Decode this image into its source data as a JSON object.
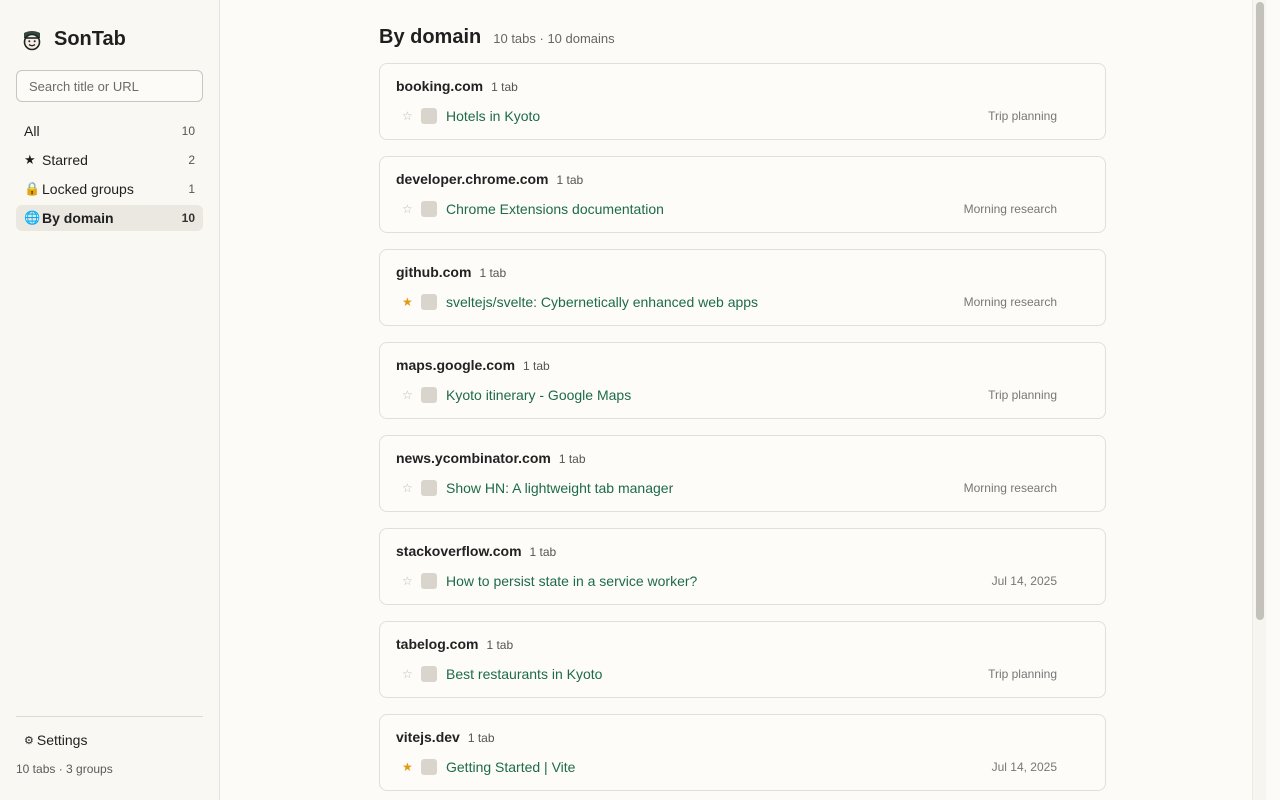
{
  "sidebar": {
    "brand": "SonTab",
    "search_placeholder": "Search title or URL",
    "nav": [
      {
        "icon": "",
        "label": "All",
        "count": "10",
        "active": false
      },
      {
        "icon": "★",
        "label": "Starred",
        "count": "2",
        "active": false
      },
      {
        "icon": "🔒",
        "label": "Locked groups",
        "count": "1",
        "active": false
      },
      {
        "icon": "🌐",
        "label": "By domain",
        "count": "10",
        "active": true
      }
    ],
    "settings_icon": "⚙",
    "settings_label": "Settings",
    "summary": "10 tabs · 3 groups"
  },
  "main": {
    "title": "By domain",
    "subtitle": "10 tabs · 10 domains",
    "groups": [
      {
        "domain": "booking.com",
        "count": "1 tab",
        "tabs": [
          {
            "title": "Hotels in Kyoto",
            "meta": "Trip planning",
            "starred": false
          }
        ]
      },
      {
        "domain": "developer.chrome.com",
        "count": "1 tab",
        "tabs": [
          {
            "title": "Chrome Extensions documentation",
            "meta": "Morning research",
            "starred": false
          }
        ]
      },
      {
        "domain": "github.com",
        "count": "1 tab",
        "tabs": [
          {
            "title": "sveltejs/svelte: Cybernetically enhanced web apps",
            "meta": "Morning research",
            "starred": true
          }
        ]
      },
      {
        "domain": "maps.google.com",
        "count": "1 tab",
        "tabs": [
          {
            "title": "Kyoto itinerary - Google Maps",
            "meta": "Trip planning",
            "starred": false
          }
        ]
      },
      {
        "domain": "news.ycombinator.com",
        "count": "1 tab",
        "tabs": [
          {
            "title": "Show HN: A lightweight tab manager",
            "meta": "Morning research",
            "starred": false
          }
        ]
      },
      {
        "domain": "stackoverflow.com",
        "count": "1 tab",
        "tabs": [
          {
            "title": "How to persist state in a service worker?",
            "meta": "Jul 14, 2025",
            "starred": false
          }
        ]
      },
      {
        "domain": "tabelog.com",
        "count": "1 tab",
        "tabs": [
          {
            "title": "Best restaurants in Kyoto",
            "meta": "Trip planning",
            "starred": false
          }
        ]
      },
      {
        "domain": "vitejs.dev",
        "count": "1 tab",
        "tabs": [
          {
            "title": "Getting Started | Vite",
            "meta": "Jul 14, 2025",
            "starred": true
          }
        ]
      }
    ]
  },
  "icons": {
    "star_on": "★",
    "star_off": "☆"
  },
  "colors": {
    "accent_link": "#1e6b47",
    "star": "#e29a12",
    "background": "#fcfbf7"
  }
}
